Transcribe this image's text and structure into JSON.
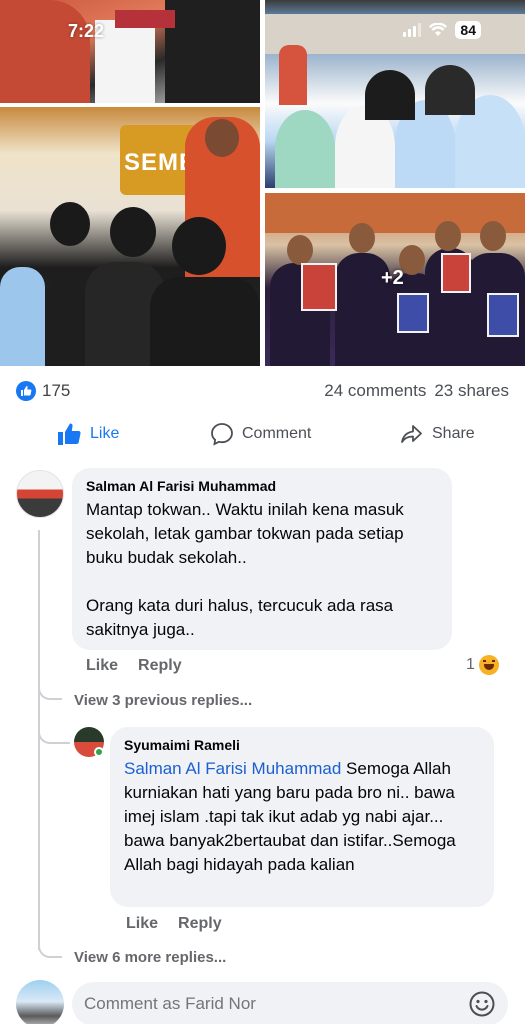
{
  "status_bar": {
    "time": "7:22",
    "battery": "84"
  },
  "photos": {
    "banner_text": "SEMETA",
    "more_count": "+2"
  },
  "post_stats": {
    "likes": "175",
    "comments": "24 comments",
    "shares": "23 shares"
  },
  "actions": {
    "like": "Like",
    "comment": "Comment",
    "share": "Share"
  },
  "comments": [
    {
      "author": "Salman Al Farisi Muhammad",
      "text": "Mantap tokwan.. Waktu inilah kena masuk sekolah, letak gambar tokwan pada setiap buku budak sekolah..\n\nOrang kata duri halus, tercucuk ada rasa sakitnya juga..",
      "like_label": "Like",
      "reply_label": "Reply",
      "reaction_count": "1"
    },
    {
      "author": "Syumaimi Rameli",
      "mention": "Salman Al Farisi Muhammad",
      "text": " Semoga Allah kurniakan hati yang baru pada bro ni.. bawa imej islam .tapi tak ikut adab yg nabi ajar... bawa banyak2bertaubat dan istifar..Semoga Allah bagi hidayah pada kalian",
      "like_label": "Like",
      "reply_label": "Reply"
    }
  ],
  "view_previous_replies": "View 3 previous replies...",
  "view_more_replies": "View 6 more replies...",
  "composer": {
    "placeholder": "Comment as Farid Nor"
  },
  "colors": {
    "accent": "#1877f2",
    "bubble": "#f0f2f5",
    "muted": "#65676b",
    "mention": "#1b5fd1"
  }
}
